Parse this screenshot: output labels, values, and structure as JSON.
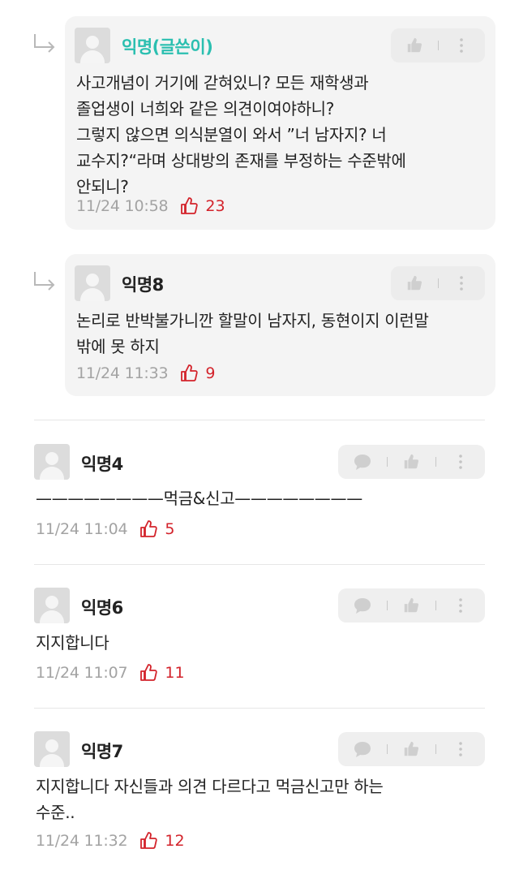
{
  "comments": [
    {
      "author": "익명(글쓴이)",
      "is_reply": true,
      "is_op": true,
      "text": "사고개념이 거기에 갇혀있니? 모든 재학생과\n졸업생이 너희와 같은 의견이여야하니?\n그렇지 않으면 의식분열이 와서 ”너 남자지? 너\n교수지?“라며 상대방의 존재를 부정하는 수준밖에\n안되니?",
      "time": "11/24 10:58",
      "likes": "23"
    },
    {
      "author": "익명8",
      "is_reply": true,
      "is_op": false,
      "text": "논리로 반박불가니깐 할말이 남자지, 동현이지 이런말\n밖에 못 하지",
      "time": "11/24 11:33",
      "likes": "9"
    },
    {
      "author": "익명4",
      "is_reply": false,
      "text": "————————먹금&신고————————",
      "time": "11/24 11:04",
      "likes": "5"
    },
    {
      "author": "익명6",
      "is_reply": false,
      "text": "지지합니다",
      "time": "11/24 11:07",
      "likes": "11"
    },
    {
      "author": "익명7",
      "is_reply": false,
      "text": "지지합니다 자신들과 의견 다르다고 먹금신고만 하는\n수준..",
      "time": "11/24 11:32",
      "likes": "12"
    }
  ],
  "colors": {
    "op_name": "#2bbfb0",
    "like": "#d3232b",
    "meta": "#a3a3a3",
    "reply_bg": "#f4f4f4"
  },
  "icons": {
    "reply_indicator": "reply-arrow-icon",
    "comment": "speech-bubble-icon",
    "like": "thumbs-up-icon",
    "more": "more-vertical-icon"
  }
}
